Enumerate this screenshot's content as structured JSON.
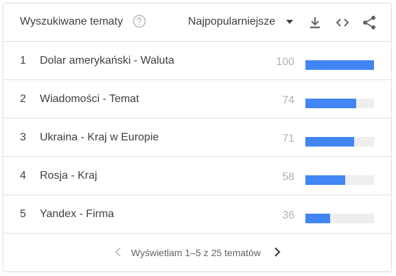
{
  "widget": {
    "title": "Wyszukiwane tematy",
    "sort_label": "Najpopularniejsze"
  },
  "colors": {
    "bar": "#4285f4",
    "track": "#eeeeee"
  },
  "rows": [
    {
      "rank": "1",
      "label": "Dolar amerykański - Waluta",
      "value": "100",
      "share": 1.0
    },
    {
      "rank": "2",
      "label": "Wiadomości - Temat",
      "value": "74",
      "share": 0.74
    },
    {
      "rank": "3",
      "label": "Ukraina - Kraj w Europie",
      "value": "71",
      "share": 0.71
    },
    {
      "rank": "4",
      "label": "Rosja - Kraj",
      "value": "58",
      "share": 0.58
    },
    {
      "rank": "5",
      "label": "Yandex - Firma",
      "value": "36",
      "share": 0.36
    }
  ],
  "pagination": {
    "text": "Wyświetlam 1–5 z 25 tematów"
  },
  "icons": {
    "help": "help-circle-icon",
    "sort_caret": "caret-down-icon",
    "download": "download-icon",
    "embed": "embed-code-icon",
    "share": "share-icon",
    "prev": "chevron-left-icon",
    "next": "chevron-right-icon"
  }
}
